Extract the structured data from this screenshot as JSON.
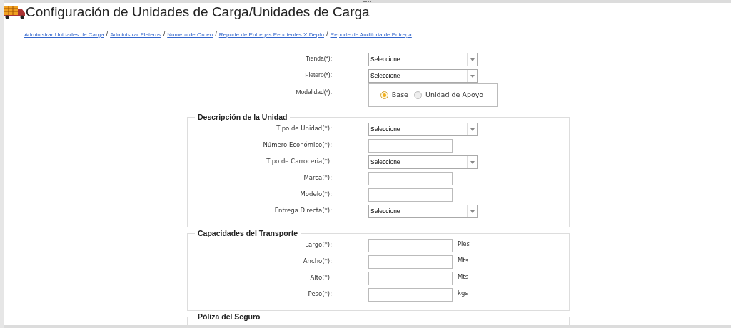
{
  "header": {
    "title": "Configuración de Unidades de Carga/Unidades de Carga",
    "links": [
      {
        "kind": "link",
        "text": "Administrar Unidades de Carga"
      },
      {
        "kind": "separator",
        "text": "/"
      },
      {
        "kind": "link",
        "text": "Administrar Fleteros"
      },
      {
        "kind": "separator",
        "text": "/"
      },
      {
        "kind": "link",
        "text": "Numero de Orden"
      },
      {
        "kind": "separator",
        "text": "/"
      },
      {
        "kind": "link",
        "text": "Reporte de Entregas Pendientes X Depto"
      },
      {
        "kind": "separator",
        "text": "/"
      },
      {
        "kind": "link",
        "text": "Reporte de Auditoria de Entrega"
      }
    ]
  },
  "fields": [
    {
      "kind": "select",
      "label": "Tienda(*):",
      "value": "Seleccione"
    },
    {
      "kind": "select",
      "label": "Fletero(*):",
      "value": "Seleccione"
    },
    {
      "kind": "radio",
      "label": "Modalidad(*):",
      "options": [
        {
          "label": "Base",
          "selected": true
        },
        {
          "label": "Unidad de Apoyo",
          "selected": false
        }
      ]
    }
  ],
  "sections": [
    {
      "legend": "Descripción de la Unidad",
      "fields": [
        {
          "kind": "select",
          "label": "Tipo de Unidad(*):",
          "value": "Seleccione"
        },
        {
          "kind": "text",
          "label": "Número Económico(*):"
        },
        {
          "kind": "select",
          "label": "Tipo de Carroceria(*):",
          "value": "Seleccione"
        },
        {
          "kind": "text",
          "label": "Marca(*):"
        },
        {
          "kind": "text",
          "label": "Modelo(*):"
        },
        {
          "kind": "select",
          "label": "Entrega Directa(*):",
          "value": "Seleccione"
        }
      ]
    },
    {
      "legend": "Capacidades del Transporte",
      "fields": [
        {
          "kind": "text",
          "label": "Largo(*):",
          "unit": "Pies"
        },
        {
          "kind": "text",
          "label": "Ancho(*):",
          "unit": "Mts"
        },
        {
          "kind": "text",
          "label": "Alto(*):",
          "unit": "Mts"
        },
        {
          "kind": "text",
          "label": "Peso(*):",
          "unit": "kgs"
        }
      ]
    },
    {
      "legend": "Póliza del Seguro"
    }
  ]
}
